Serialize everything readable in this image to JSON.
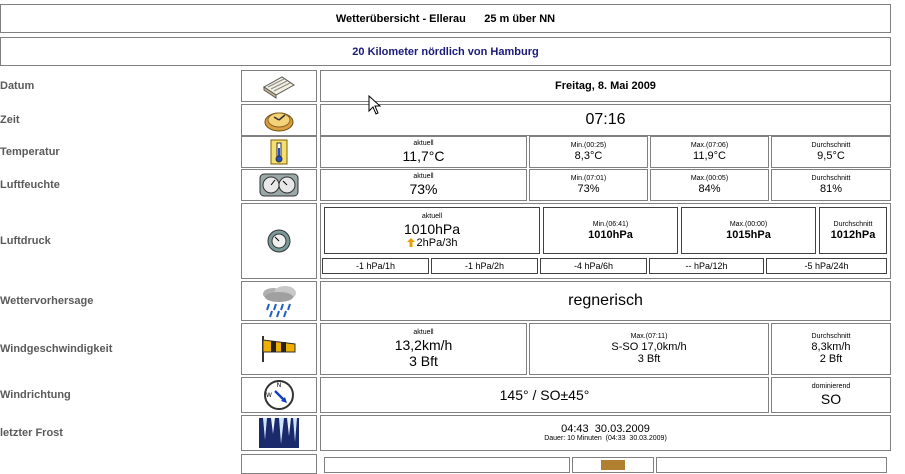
{
  "header": {
    "title": "Wetterübersicht - Ellerau      25 m über NN",
    "subtitle": "20 Kilometer nördlich von Hamburg",
    "subtitle_color": "#1a1a7a"
  },
  "rows": {
    "datum": {
      "label": "Datum",
      "icon": "calendar-icon",
      "value": "Freitag, 8. Mai 2009"
    },
    "zeit": {
      "label": "Zeit",
      "icon": "clock-icon",
      "value": "07:16"
    },
    "temperatur": {
      "label": "Temperatur",
      "icon": "thermometer-icon",
      "aktuell_caption": "aktuell",
      "aktuell": "11,7°C",
      "min_caption": "Min.(00:25)",
      "min": "8,3°C",
      "max_caption": "Max.(07:06)",
      "max": "11,9°C",
      "avg_caption": "Durchschnitt",
      "avg": "9,5°C"
    },
    "luftfeuchte": {
      "label": "Luftfeuchte",
      "icon": "hygrometer-icon",
      "aktuell_caption": "aktuell",
      "aktuell": "73%",
      "min_caption": "Min.(07:01)",
      "min": "73%",
      "max_caption": "Max.(00:05)",
      "max": "84%",
      "avg_caption": "Durchschnitt",
      "avg": "81%"
    },
    "luftdruck": {
      "label": "Luftdruck",
      "icon": "barometer-icon",
      "aktuell_caption": "aktuell",
      "aktuell": "1010hPa",
      "trend": "2hPa/3h",
      "min_caption": "Min.(06:41)",
      "min": "1010hPa",
      "max_caption": "Max.(00:00)",
      "max": "1015hPa",
      "avg_caption": "Durchschnitt",
      "avg": "1012hPa",
      "changes": [
        "-1 hPa/1h",
        "-1 hPa/2h",
        "-4 hPa/6h",
        "-- hPa/12h",
        "-5 hPa/24h"
      ]
    },
    "wettervorhersage": {
      "label": "Wettervorhersage",
      "icon": "rain-cloud-icon",
      "value": "regnerisch"
    },
    "windgeschwindigkeit": {
      "label": "Windgeschwindigkeit",
      "icon": "windsock-icon",
      "aktuell_caption": "aktuell",
      "aktuell": "13,2km/h",
      "aktuell_bft": "3 Bft",
      "max_caption": "Max.(07:11)",
      "max": "S-SO 17,0km/h",
      "max_bft": "3 Bft",
      "avg_caption": "Durchschnitt",
      "avg": "8,3km/h",
      "avg_bft": "2 Bft"
    },
    "windrichtung": {
      "label": "Windrichtung",
      "icon": "compass-icon",
      "value": "145° / SO±45°",
      "dom_caption": "dominierend",
      "dom": "SO"
    },
    "frost": {
      "label": "letzter Frost",
      "icon": "icicles-icon",
      "value": "04:43  30.03.2009",
      "duration": "Dauer: 10 Minuten  (04:33  30.03.2009)"
    }
  },
  "colors": {
    "label": "#5a5a5a",
    "trend_arrow": "#e8a000"
  }
}
